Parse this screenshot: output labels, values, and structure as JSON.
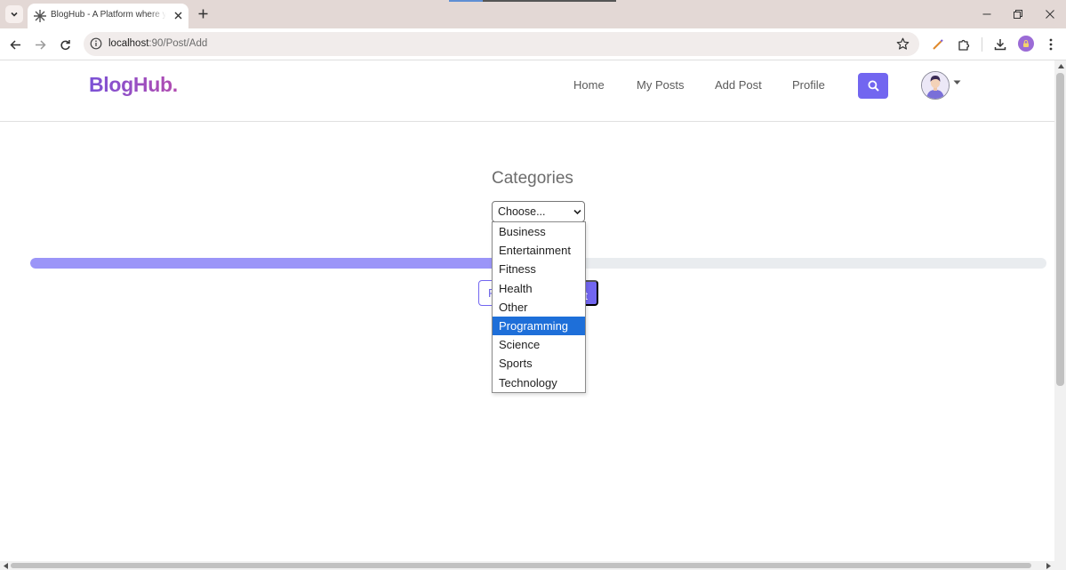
{
  "browser": {
    "tab_title": "BlogHub - A Platform where you can share",
    "url_host": "localhost",
    "url_path": ":90/Post/Add",
    "icons": {
      "tab_menu": "chevron-down-icon",
      "favicon": "snowflake-icon",
      "close": "close-icon",
      "new_tab": "plus-icon",
      "back": "arrow-left-icon",
      "forward": "arrow-right-icon",
      "reload": "reload-icon",
      "info": "info-icon",
      "bookmark": "star-icon",
      "extension_pen": "pen-icon",
      "extensions": "puzzle-icon",
      "download": "download-icon",
      "menu": "kebab-menu-icon"
    }
  },
  "navbar": {
    "brand": "BlogHub.",
    "links": [
      "Home",
      "My Posts",
      "Add Post",
      "Profile"
    ],
    "search_icon": "search-icon"
  },
  "form": {
    "section_title": "Categories",
    "select_value": "Choose...",
    "options": [
      "Business",
      "Entertainment",
      "Fitness",
      "Health",
      "Other",
      "Programming",
      "Science",
      "Sports",
      "Technology"
    ],
    "highlighted_option": "Programming",
    "progress_fraction": 0.46,
    "prev_label": "Previous",
    "next_label": "Next"
  },
  "colors": {
    "accent": "#7266f0",
    "progress_fill": "#9b95f8",
    "highlight": "#1e6fd9"
  }
}
